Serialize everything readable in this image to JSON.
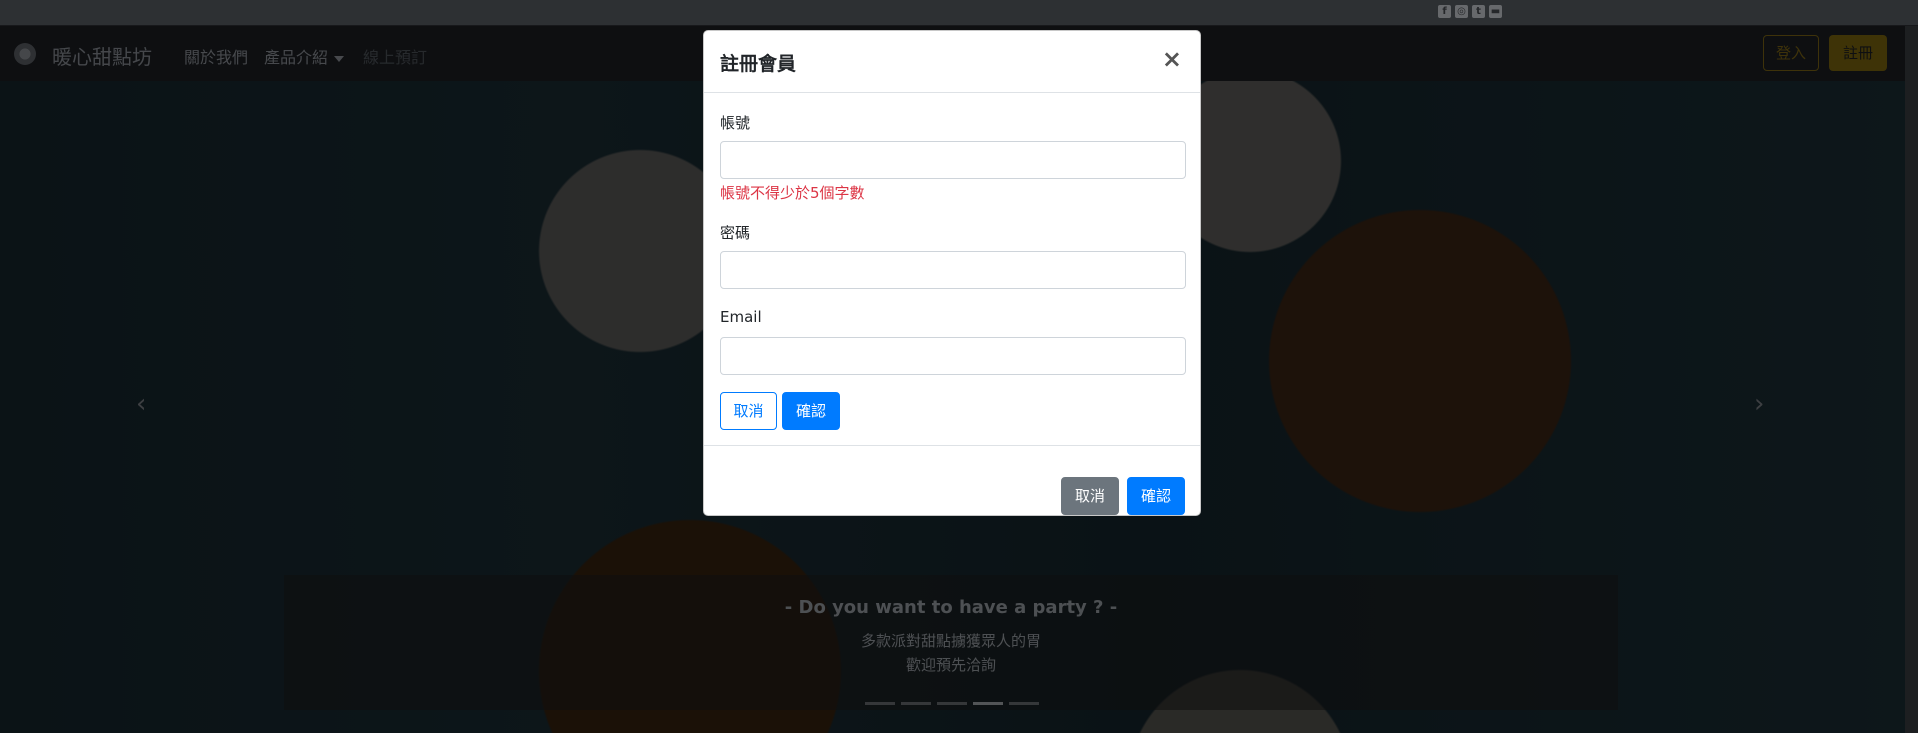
{
  "nav": {
    "brand": "暖心甜點坊",
    "links": [
      "關於我們",
      "產品介紹",
      "線上預訂"
    ],
    "login": "登入",
    "register": "註冊"
  },
  "hero": {
    "title": "- Do you want to have a party ? -",
    "line1": "多款派對甜點擄獲眾人的胃",
    "line2": "歡迎預先洽詢",
    "slide_count": 5,
    "active_slide": 4
  },
  "modal": {
    "title": "註冊會員",
    "account_label": "帳號",
    "account_error": "帳號不得少於5個字數",
    "password_label": "密碼",
    "email_label": "Email",
    "cancel": "取消",
    "confirm": "確認",
    "footer_cancel": "取消",
    "footer_confirm": "確認"
  },
  "colors": {
    "primary": "#007bff",
    "danger": "#dc3545",
    "secondary": "#6c757d",
    "warning": "#7d660f"
  }
}
